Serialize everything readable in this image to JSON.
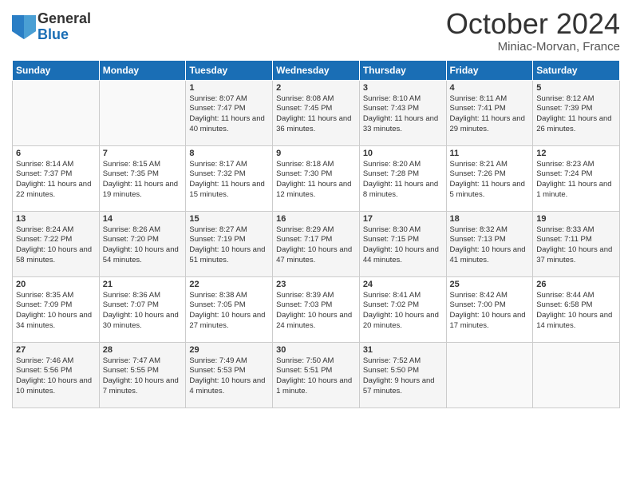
{
  "logo": {
    "general": "General",
    "blue": "Blue"
  },
  "title": "October 2024",
  "subtitle": "Miniac-Morvan, France",
  "days_header": [
    "Sunday",
    "Monday",
    "Tuesday",
    "Wednesday",
    "Thursday",
    "Friday",
    "Saturday"
  ],
  "weeks": [
    [
      {
        "day": "",
        "sunrise": "",
        "sunset": "",
        "daylight": ""
      },
      {
        "day": "",
        "sunrise": "",
        "sunset": "",
        "daylight": ""
      },
      {
        "day": "1",
        "sunrise": "Sunrise: 8:07 AM",
        "sunset": "Sunset: 7:47 PM",
        "daylight": "Daylight: 11 hours and 40 minutes."
      },
      {
        "day": "2",
        "sunrise": "Sunrise: 8:08 AM",
        "sunset": "Sunset: 7:45 PM",
        "daylight": "Daylight: 11 hours and 36 minutes."
      },
      {
        "day": "3",
        "sunrise": "Sunrise: 8:10 AM",
        "sunset": "Sunset: 7:43 PM",
        "daylight": "Daylight: 11 hours and 33 minutes."
      },
      {
        "day": "4",
        "sunrise": "Sunrise: 8:11 AM",
        "sunset": "Sunset: 7:41 PM",
        "daylight": "Daylight: 11 hours and 29 minutes."
      },
      {
        "day": "5",
        "sunrise": "Sunrise: 8:12 AM",
        "sunset": "Sunset: 7:39 PM",
        "daylight": "Daylight: 11 hours and 26 minutes."
      }
    ],
    [
      {
        "day": "6",
        "sunrise": "Sunrise: 8:14 AM",
        "sunset": "Sunset: 7:37 PM",
        "daylight": "Daylight: 11 hours and 22 minutes."
      },
      {
        "day": "7",
        "sunrise": "Sunrise: 8:15 AM",
        "sunset": "Sunset: 7:35 PM",
        "daylight": "Daylight: 11 hours and 19 minutes."
      },
      {
        "day": "8",
        "sunrise": "Sunrise: 8:17 AM",
        "sunset": "Sunset: 7:32 PM",
        "daylight": "Daylight: 11 hours and 15 minutes."
      },
      {
        "day": "9",
        "sunrise": "Sunrise: 8:18 AM",
        "sunset": "Sunset: 7:30 PM",
        "daylight": "Daylight: 11 hours and 12 minutes."
      },
      {
        "day": "10",
        "sunrise": "Sunrise: 8:20 AM",
        "sunset": "Sunset: 7:28 PM",
        "daylight": "Daylight: 11 hours and 8 minutes."
      },
      {
        "day": "11",
        "sunrise": "Sunrise: 8:21 AM",
        "sunset": "Sunset: 7:26 PM",
        "daylight": "Daylight: 11 hours and 5 minutes."
      },
      {
        "day": "12",
        "sunrise": "Sunrise: 8:23 AM",
        "sunset": "Sunset: 7:24 PM",
        "daylight": "Daylight: 11 hours and 1 minute."
      }
    ],
    [
      {
        "day": "13",
        "sunrise": "Sunrise: 8:24 AM",
        "sunset": "Sunset: 7:22 PM",
        "daylight": "Daylight: 10 hours and 58 minutes."
      },
      {
        "day": "14",
        "sunrise": "Sunrise: 8:26 AM",
        "sunset": "Sunset: 7:20 PM",
        "daylight": "Daylight: 10 hours and 54 minutes."
      },
      {
        "day": "15",
        "sunrise": "Sunrise: 8:27 AM",
        "sunset": "Sunset: 7:19 PM",
        "daylight": "Daylight: 10 hours and 51 minutes."
      },
      {
        "day": "16",
        "sunrise": "Sunrise: 8:29 AM",
        "sunset": "Sunset: 7:17 PM",
        "daylight": "Daylight: 10 hours and 47 minutes."
      },
      {
        "day": "17",
        "sunrise": "Sunrise: 8:30 AM",
        "sunset": "Sunset: 7:15 PM",
        "daylight": "Daylight: 10 hours and 44 minutes."
      },
      {
        "day": "18",
        "sunrise": "Sunrise: 8:32 AM",
        "sunset": "Sunset: 7:13 PM",
        "daylight": "Daylight: 10 hours and 41 minutes."
      },
      {
        "day": "19",
        "sunrise": "Sunrise: 8:33 AM",
        "sunset": "Sunset: 7:11 PM",
        "daylight": "Daylight: 10 hours and 37 minutes."
      }
    ],
    [
      {
        "day": "20",
        "sunrise": "Sunrise: 8:35 AM",
        "sunset": "Sunset: 7:09 PM",
        "daylight": "Daylight: 10 hours and 34 minutes."
      },
      {
        "day": "21",
        "sunrise": "Sunrise: 8:36 AM",
        "sunset": "Sunset: 7:07 PM",
        "daylight": "Daylight: 10 hours and 30 minutes."
      },
      {
        "day": "22",
        "sunrise": "Sunrise: 8:38 AM",
        "sunset": "Sunset: 7:05 PM",
        "daylight": "Daylight: 10 hours and 27 minutes."
      },
      {
        "day": "23",
        "sunrise": "Sunrise: 8:39 AM",
        "sunset": "Sunset: 7:03 PM",
        "daylight": "Daylight: 10 hours and 24 minutes."
      },
      {
        "day": "24",
        "sunrise": "Sunrise: 8:41 AM",
        "sunset": "Sunset: 7:02 PM",
        "daylight": "Daylight: 10 hours and 20 minutes."
      },
      {
        "day": "25",
        "sunrise": "Sunrise: 8:42 AM",
        "sunset": "Sunset: 7:00 PM",
        "daylight": "Daylight: 10 hours and 17 minutes."
      },
      {
        "day": "26",
        "sunrise": "Sunrise: 8:44 AM",
        "sunset": "Sunset: 6:58 PM",
        "daylight": "Daylight: 10 hours and 14 minutes."
      }
    ],
    [
      {
        "day": "27",
        "sunrise": "Sunrise: 7:46 AM",
        "sunset": "Sunset: 5:56 PM",
        "daylight": "Daylight: 10 hours and 10 minutes."
      },
      {
        "day": "28",
        "sunrise": "Sunrise: 7:47 AM",
        "sunset": "Sunset: 5:55 PM",
        "daylight": "Daylight: 10 hours and 7 minutes."
      },
      {
        "day": "29",
        "sunrise": "Sunrise: 7:49 AM",
        "sunset": "Sunset: 5:53 PM",
        "daylight": "Daylight: 10 hours and 4 minutes."
      },
      {
        "day": "30",
        "sunrise": "Sunrise: 7:50 AM",
        "sunset": "Sunset: 5:51 PM",
        "daylight": "Daylight: 10 hours and 1 minute."
      },
      {
        "day": "31",
        "sunrise": "Sunrise: 7:52 AM",
        "sunset": "Sunset: 5:50 PM",
        "daylight": "Daylight: 9 hours and 57 minutes."
      },
      {
        "day": "",
        "sunrise": "",
        "sunset": "",
        "daylight": ""
      },
      {
        "day": "",
        "sunrise": "",
        "sunset": "",
        "daylight": ""
      }
    ]
  ]
}
